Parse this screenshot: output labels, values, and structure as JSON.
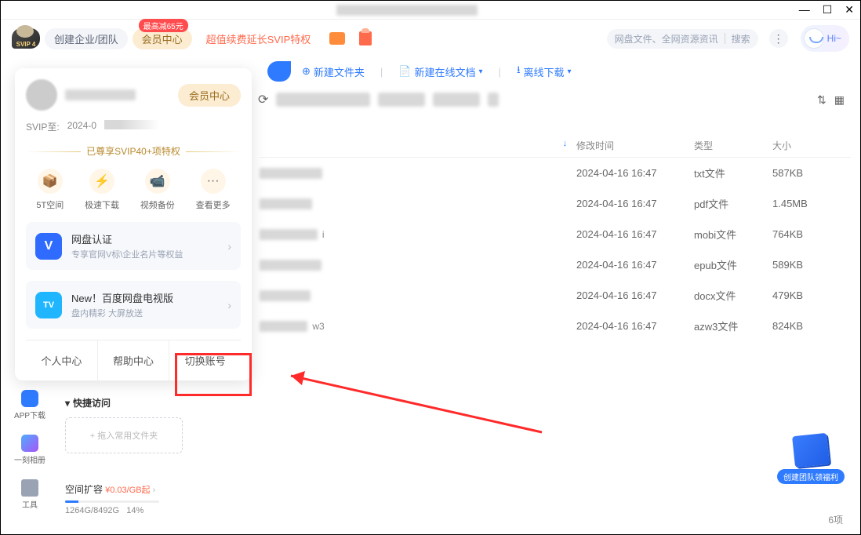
{
  "window": {
    "svip_badge": "SVIP 4"
  },
  "topbar": {
    "create_team": "创建企业/团队",
    "member_center": "会员中心",
    "promo_badge": "最高减65元",
    "renew_text": "超值续费延长SVIP特权",
    "search_placeholder": "网盘文件、全网资源资讯",
    "search_btn": "搜索",
    "hi": "Hi~"
  },
  "actions": {
    "new_folder": "新建文件夹",
    "new_doc": "新建在线文档",
    "offline_dl": "离线下载"
  },
  "table": {
    "sort_arrow": "↓",
    "h_date": "修改时间",
    "h_type": "类型",
    "h_size": "大小",
    "rows": [
      {
        "date": "2024-04-16 16:47",
        "type": "txt文件",
        "size": "587KB",
        "tail": ""
      },
      {
        "date": "2024-04-16 16:47",
        "type": "pdf文件",
        "size": "1.45MB",
        "tail": ""
      },
      {
        "date": "2024-04-16 16:47",
        "type": "mobi文件",
        "size": "764KB",
        "tail": "i"
      },
      {
        "date": "2024-04-16 16:47",
        "type": "epub文件",
        "size": "589KB",
        "tail": ""
      },
      {
        "date": "2024-04-16 16:47",
        "type": "docx文件",
        "size": "479KB",
        "tail": ""
      },
      {
        "date": "2024-04-16 16:47",
        "type": "azw3文件",
        "size": "824KB",
        "tail": "w3"
      }
    ]
  },
  "panel": {
    "member_center": "会员中心",
    "svip_until_label": "SVIP至:",
    "svip_date_partial": "2024-0",
    "gold_text": "已尊享SVIP40+项特权",
    "features": [
      {
        "icon": "📦",
        "label": "5T空间"
      },
      {
        "icon": "⚡",
        "label": "极速下载"
      },
      {
        "icon": "📹",
        "label": "视频备份"
      },
      {
        "icon": "···",
        "label": "查看更多"
      }
    ],
    "card1": {
      "title": "网盘认证",
      "sub": "专享官网V标\\企业名片等权益",
      "icon": "V",
      "color": "#2f6bff"
    },
    "card2": {
      "title": "New！百度网盘电视版",
      "sub": "盘内精彩 大屏放送",
      "icon": "TV",
      "color": "#1fb6ff"
    },
    "footer": {
      "personal": "个人中心",
      "help": "帮助中心",
      "switch": "切换账号"
    }
  },
  "leftbar": {
    "app": "APP下载",
    "album": "一刻相册",
    "tools": "工具"
  },
  "quick": {
    "title": "快捷访问",
    "drop": "+ 拖入常用文件夹"
  },
  "storage": {
    "title": "空间扩容",
    "price": "¥0.03/GB起",
    "usage": "1264G/8492G",
    "percent_text": "14%",
    "percent_num": 14
  },
  "bottom": {
    "count": "6项",
    "float_badge": "创建团队领福利"
  }
}
